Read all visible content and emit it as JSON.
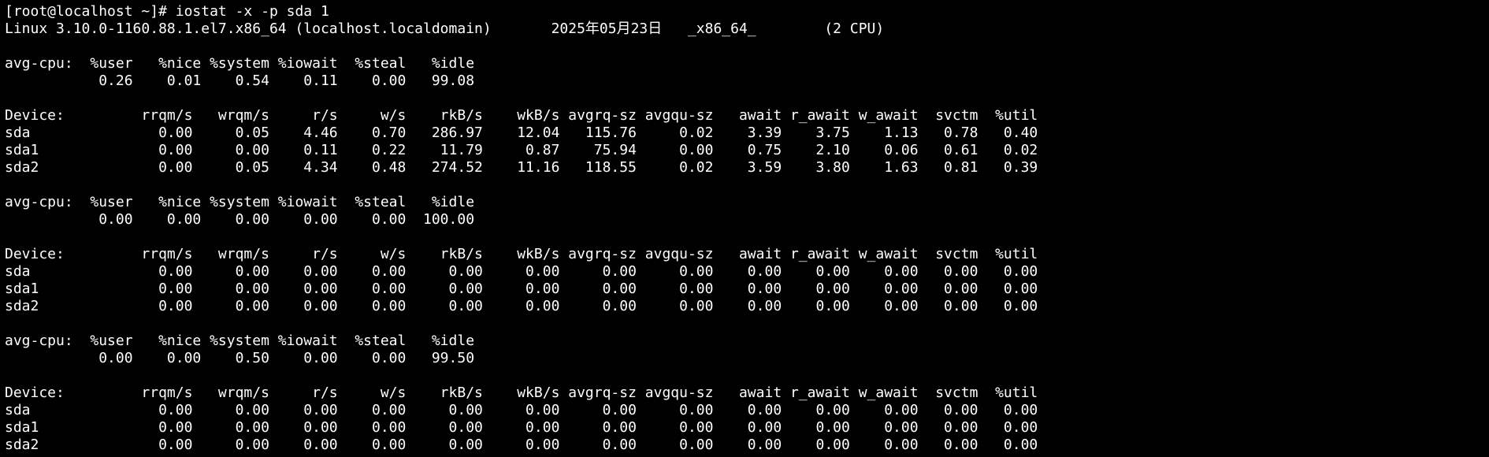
{
  "terminal": {
    "background": "#000000",
    "foreground": "#ffffff",
    "lines": [
      "[root@localhost ~]# iostat -x -p sda 1",
      "Linux 3.10.0-1160.88.1.el7.x86_64 (localhost.localdomain) \t2025年05月23日 \t_x86_64_\t(2 CPU)",
      "",
      "avg-cpu:  %user   %nice %system %iowait  %steal   %idle",
      "           0.26    0.01    0.54    0.11    0.00   99.08",
      "",
      "Device:         rrqm/s   wrqm/s     r/s     w/s    rkB/s    wkB/s avgrq-sz avgqu-sz   await r_await w_await  svctm  %util",
      "sda               0.00     0.05    4.46    0.70   286.97    12.04   115.76     0.02    3.39    3.75    1.13   0.78   0.40",
      "sda1              0.00     0.00    0.11    0.22    11.79     0.87    75.94     0.00    0.75    2.10    0.06   0.61   0.02",
      "sda2              0.00     0.05    4.34    0.48   274.52    11.16   118.55     0.02    3.59    3.80    1.63   0.81   0.39",
      "",
      "avg-cpu:  %user   %nice %system %iowait  %steal   %idle",
      "           0.00    0.00    0.00    0.00    0.00  100.00",
      "",
      "Device:         rrqm/s   wrqm/s     r/s     w/s    rkB/s    wkB/s avgrq-sz avgqu-sz   await r_await w_await  svctm  %util",
      "sda               0.00     0.00    0.00    0.00     0.00     0.00     0.00     0.00    0.00    0.00    0.00   0.00   0.00",
      "sda1              0.00     0.00    0.00    0.00     0.00     0.00     0.00     0.00    0.00    0.00    0.00   0.00   0.00",
      "sda2              0.00     0.00    0.00    0.00     0.00     0.00     0.00     0.00    0.00    0.00    0.00   0.00   0.00",
      "",
      "avg-cpu:  %user   %nice %system %iowait  %steal   %idle",
      "           0.00    0.00    0.50    0.00    0.00   99.50",
      "",
      "Device:         rrqm/s   wrqm/s     r/s     w/s    rkB/s    wkB/s avgrq-sz avgqu-sz   await r_await w_await  svctm  %util",
      "sda               0.00     0.00    0.00    0.00     0.00     0.00     0.00     0.00    0.00    0.00    0.00   0.00   0.00",
      "sda1              0.00     0.00    0.00    0.00     0.00     0.00     0.00     0.00    0.00    0.00    0.00   0.00   0.00",
      "sda2              0.00     0.00    0.00    0.00     0.00     0.00     0.00     0.00    0.00    0.00    0.00   0.00   0.00"
    ]
  }
}
